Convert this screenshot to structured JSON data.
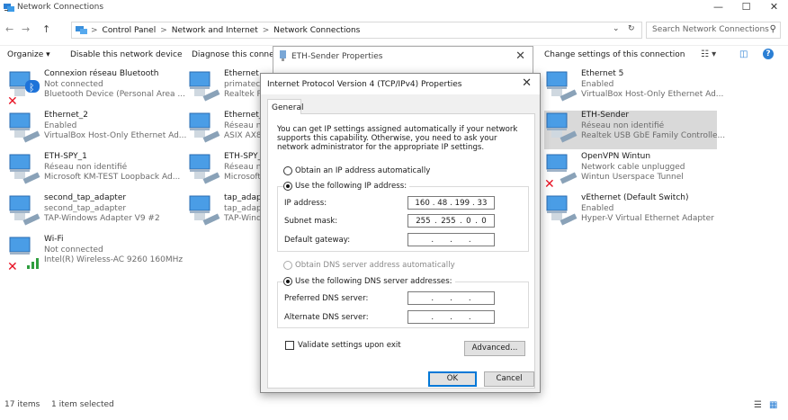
{
  "window": {
    "title": "Network Connections",
    "controls": [
      "—",
      "☐",
      "✕"
    ]
  },
  "addressbar": {
    "back": "←",
    "forward": "→",
    "up": "↑",
    "crumbs": [
      "Control Panel",
      "Network and Internet",
      "Network Connections"
    ],
    "separator": ">",
    "dropdown": "⌄",
    "refresh": "↻",
    "search_placeholder": "Search Network Connections"
  },
  "commandbar": {
    "organize": "Organize ▾",
    "disable": "Disable this network device",
    "diagnose": "Diagnose this connec",
    "change_settings": "Change settings of this connection",
    "view_options": "☷ ▾",
    "pane": "◫",
    "help": "?"
  },
  "adapters_col1": [
    {
      "name": "Connexion réseau Bluetooth",
      "status": "Not connected",
      "device": "Bluetooth Device (Personal Area ..."
    },
    {
      "name": "Ethernet_2",
      "status": "Enabled",
      "device": "VirtualBox Host-Only Ethernet Ad..."
    },
    {
      "name": "ETH-SPY_1",
      "status": "Réseau non identifié",
      "device": "Microsoft KM-TEST Loopback Ad..."
    },
    {
      "name": "second_tap_adapter",
      "status": "second_tap_adapter",
      "device": "TAP-Windows Adapter V9 #2"
    },
    {
      "name": "Wi-Fi",
      "status": "Not connected",
      "device": "Intel(R) Wireless-AC 9260 160MHz"
    }
  ],
  "adapters_col2": [
    {
      "name": "Ethernet",
      "status": "primatec.",
      "device": "Realtek P"
    },
    {
      "name": "Ethernet_",
      "status": "Réseau n",
      "device": "ASIX AX8"
    },
    {
      "name": "ETH-SPY_",
      "status": "Réseau n",
      "device": "Microsoft"
    },
    {
      "name": "tap_adapt",
      "status": "tap_adapt",
      "device": "TAP-Wind"
    }
  ],
  "adapters_col4": [
    {
      "name": "Ethernet 5",
      "status": "Enabled",
      "device": "VirtualBox Host-Only Ethernet Ad..."
    },
    {
      "name": "ETH-Sender",
      "status": "Réseau non identifié",
      "device": "Realtek USB GbE Family Controlle..."
    },
    {
      "name": "OpenVPN Wintun",
      "status": "Network cable unplugged",
      "device": "Wintun Userspace Tunnel"
    },
    {
      "name": "vEthernet (Default Switch)",
      "status": "Enabled",
      "device": "Hyper-V Virtual Ethernet Adapter"
    }
  ],
  "statusbar": {
    "items": "17 items",
    "selected": "1 item selected"
  },
  "props_dialog": {
    "title": "ETH-Sender Properties",
    "close": "✕"
  },
  "ipv4_dialog": {
    "title": "Internet Protocol Version 4 (TCP/IPv4) Properties",
    "close": "✕",
    "tab": "General",
    "description": "You can get IP settings assigned automatically if your network supports this capability. Otherwise, you need to ask your network administrator for the appropriate IP settings.",
    "auto_ip": "Obtain an IP address automatically",
    "use_ip": "Use the following IP address:",
    "ip_label": "IP address:",
    "ip_value": [
      "160",
      "48",
      "199",
      "33"
    ],
    "mask_label": "Subnet mask:",
    "mask_value": [
      "255",
      "255",
      "0",
      "0"
    ],
    "gateway_label": "Default gateway:",
    "auto_dns": "Obtain DNS server address automatically",
    "use_dns": "Use the following DNS server addresses:",
    "pref_dns_label": "Preferred DNS server:",
    "alt_dns_label": "Alternate DNS server:",
    "dot": ".",
    "validate": "Validate settings upon exit",
    "advanced": "Advanced...",
    "ok": "OK",
    "cancel": "Cancel"
  },
  "colors": {
    "selection": "#cce8ff",
    "accent": "#0078d7",
    "error_red": "#e81123"
  }
}
